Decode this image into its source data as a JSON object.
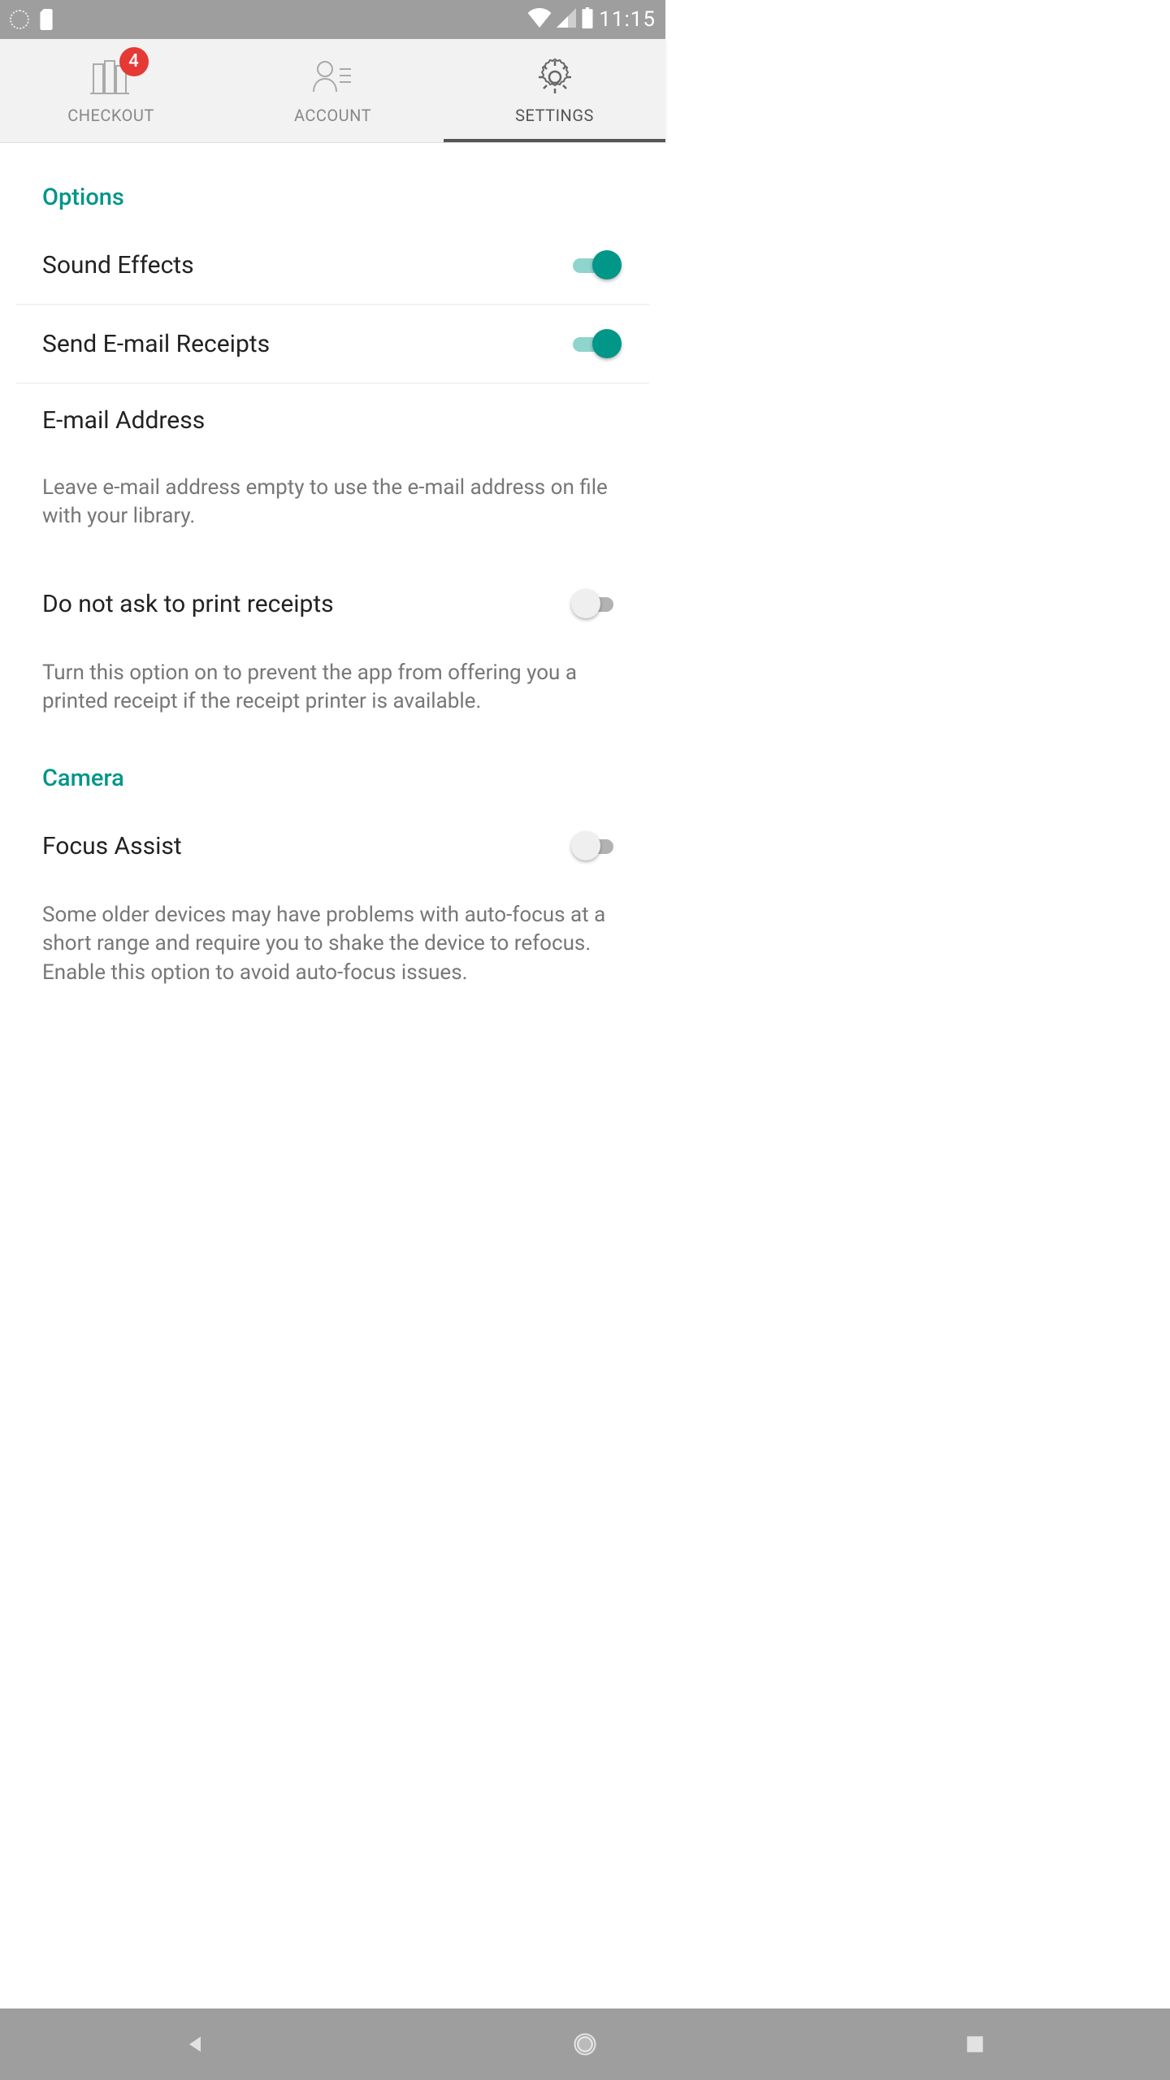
{
  "status": {
    "time": "11:15"
  },
  "tabs": {
    "checkout": {
      "label": "CHECKOUT",
      "badge": "4"
    },
    "account": {
      "label": "ACCOUNT"
    },
    "settings": {
      "label": "SETTINGS"
    }
  },
  "sections": {
    "options": {
      "header": "Options",
      "sound_effects": {
        "label": "Sound Effects",
        "on": true
      },
      "send_receipts": {
        "label": "Send E-mail Receipts",
        "on": true
      },
      "email_address": {
        "label": "E-mail Address",
        "description": "Leave e-mail address empty to use the e-mail address on file with your library."
      },
      "no_print": {
        "label": "Do not ask to print receipts",
        "on": false,
        "description": "Turn this option on to prevent the app from offering you a printed receipt if the receipt printer is available."
      }
    },
    "camera": {
      "header": "Camera",
      "focus_assist": {
        "label": "Focus Assist",
        "on": false,
        "description": "Some older devices may have problems with auto-focus at a short range and require you to shake the device to refocus. Enable this option to avoid auto-focus issues."
      }
    }
  }
}
